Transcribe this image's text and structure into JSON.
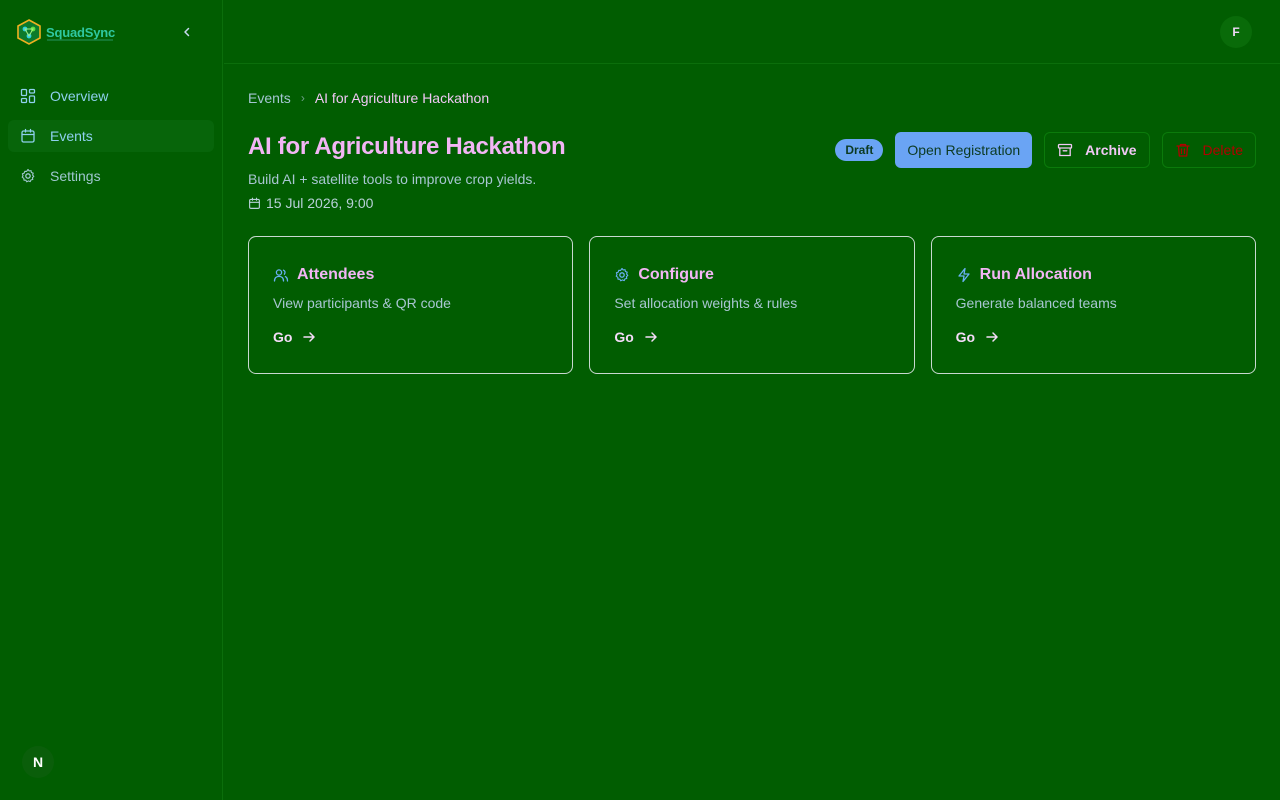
{
  "app": {
    "name": "SquadSync",
    "user_initial": "F",
    "footer_badge": "N"
  },
  "sidebar": {
    "items": [
      {
        "label": "Overview",
        "icon": "layout-grid-icon"
      },
      {
        "label": "Events",
        "icon": "calendar-icon"
      },
      {
        "label": "Settings",
        "icon": "gear-icon"
      }
    ]
  },
  "breadcrumb": {
    "parent": "Events",
    "separator": "›",
    "current": "AI for Agriculture Hackathon"
  },
  "event": {
    "title": "AI for Agriculture Hackathon",
    "description": "Build AI + satellite tools to improve crop yields.",
    "date": "15 Jul 2026, 9:00",
    "status": "Draft"
  },
  "actions": {
    "open_registration": "Open Registration",
    "archive": "Archive",
    "delete": "Delete"
  },
  "cards": [
    {
      "title": "Attendees",
      "description": "View participants & QR code",
      "go": "Go",
      "icon": "users-icon"
    },
    {
      "title": "Configure",
      "description": "Set allocation weights & rules",
      "go": "Go",
      "icon": "gear-icon"
    },
    {
      "title": "Run Allocation",
      "description": "Generate balanced teams",
      "go": "Go",
      "icon": "lightning-icon"
    }
  ],
  "colors": {
    "background": "#015d01",
    "accent": "#6aa4f4",
    "title": "#f2b6f4",
    "danger": "#b20000"
  }
}
